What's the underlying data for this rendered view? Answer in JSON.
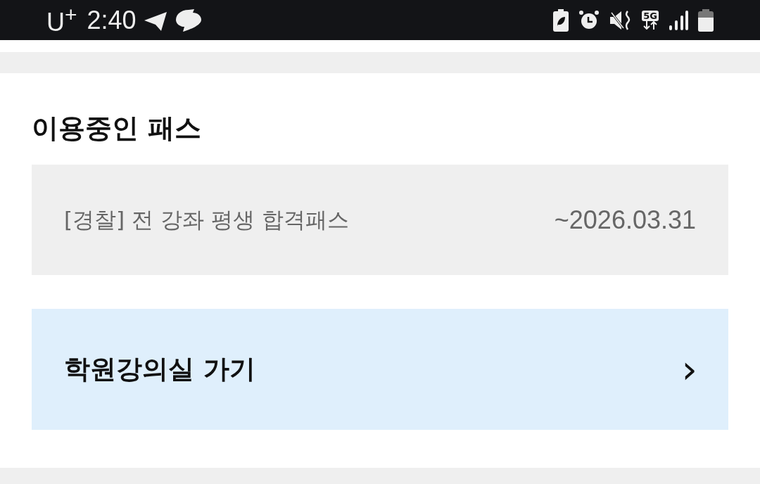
{
  "status_bar": {
    "carrier": "U$^{+}$",
    "time": "2:40",
    "network": "5G"
  },
  "section": {
    "title": "이용중인 패스"
  },
  "passes": [
    {
      "name": "[경찰] 전 강좌 평생 합격패스",
      "expiry": "~2026.03.31"
    }
  ],
  "link": {
    "label": "학원강의실 가기",
    "chevron": "›"
  }
}
